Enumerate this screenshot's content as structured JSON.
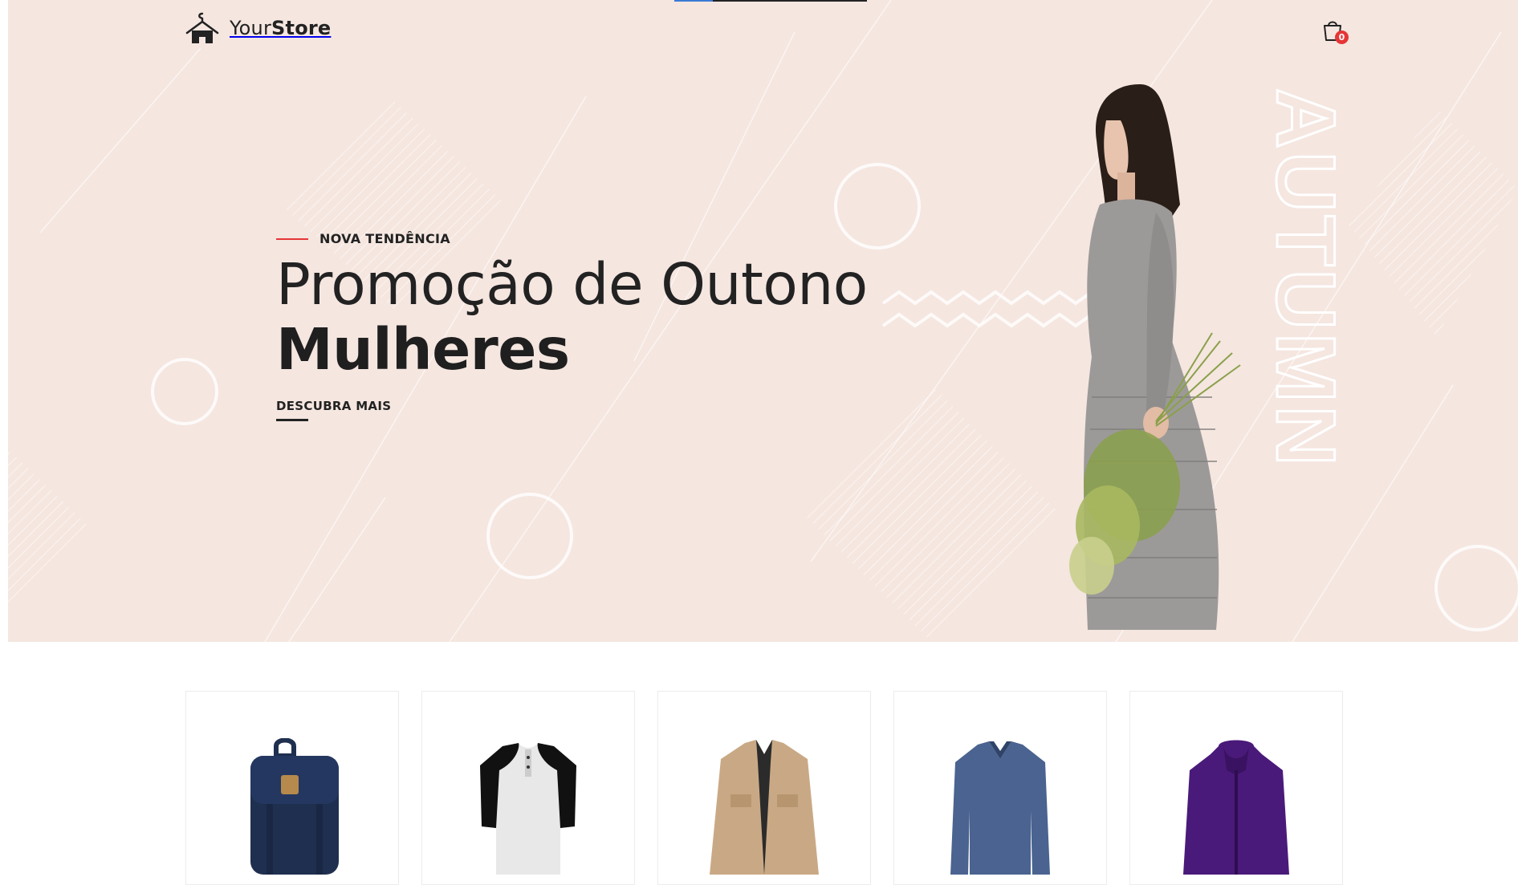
{
  "header": {
    "logo_text_light": "Your",
    "logo_text_bold": "Store",
    "cart_count": "0",
    "logo_icon": "hanger-house-icon",
    "cart_icon": "shopping-bag-icon"
  },
  "slider": {
    "progress": 0.2
  },
  "hero": {
    "eyebrow": "NOVA TENDÊNCIA",
    "title_line1": "Promoção de Outono",
    "title_line2": "Mulheres",
    "cta_label": "DESCUBRA MAIS",
    "vertical_word": "AUTUMN",
    "background_color": "#f5e6e0",
    "accent_color": "#e53637"
  },
  "products": [
    {
      "name": "backpack",
      "color": "#1f2f4f"
    },
    {
      "name": "raglan-henley-shirt",
      "color": "#e8e8e8"
    },
    {
      "name": "khaki-jacket",
      "color": "#c9a985"
    },
    {
      "name": "blue-vneck-sweater",
      "color": "#4a6390"
    },
    {
      "name": "purple-hooded-jacket",
      "color": "#4a1a7a"
    }
  ]
}
